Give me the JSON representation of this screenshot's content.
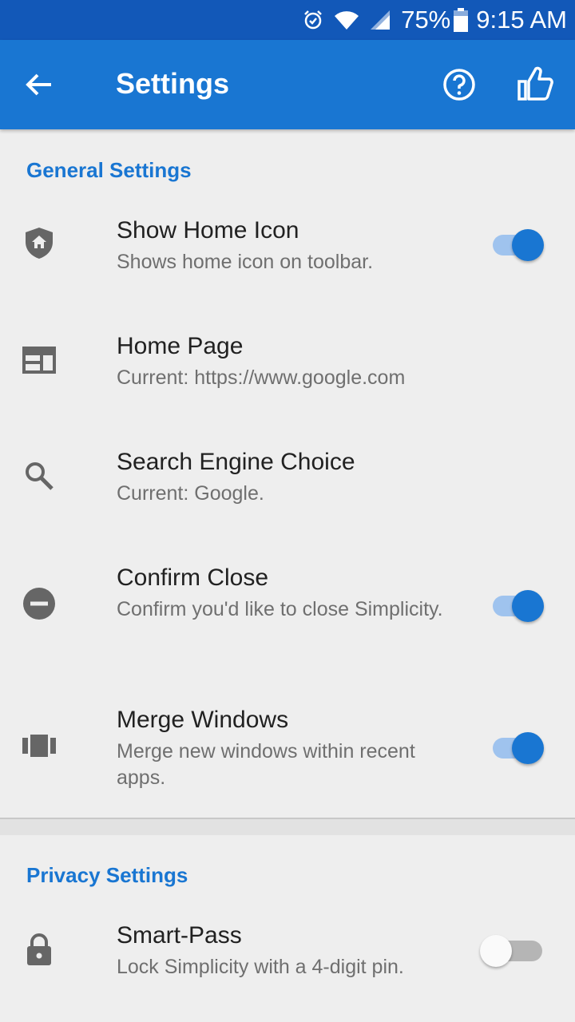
{
  "status_bar": {
    "battery_percent": "75%",
    "time": "9:15 AM",
    "icons": [
      "alarm-icon",
      "wifi-icon",
      "signal-icon",
      "battery-icon"
    ]
  },
  "app_bar": {
    "title": "Settings",
    "icons": [
      "back-arrow-icon",
      "help-icon",
      "thumbs-up-icon"
    ],
    "background": "#1976d2"
  },
  "general": {
    "header": "General Settings",
    "items": [
      {
        "title": "Show Home Icon",
        "subtitle": "Shows home icon on toolbar.",
        "icon": "shield-home-icon",
        "toggle": true
      },
      {
        "title": "Home Page",
        "subtitle": "Current: https://www.google.com",
        "icon": "web-page-icon"
      },
      {
        "title": "Search Engine Choice",
        "subtitle": "Current: Google.",
        "icon": "search-icon"
      },
      {
        "title": "Confirm Close",
        "subtitle": "Confirm you'd like to close Simplicity.",
        "icon": "minus-circle-icon",
        "toggle": true
      },
      {
        "title": "Merge Windows",
        "subtitle": "Merge new windows within recent apps.",
        "icon": "carousel-icon",
        "toggle": true
      }
    ]
  },
  "privacy": {
    "header": "Privacy Settings",
    "items": [
      {
        "title": "Smart-Pass",
        "subtitle": "Lock Simplicity with a 4-digit pin.",
        "icon": "lock-icon",
        "toggle": false
      }
    ]
  },
  "colors": {
    "accent": "#1976d2",
    "status_bar": "#1258b8",
    "switch_track_on": "#9fc3ee"
  }
}
